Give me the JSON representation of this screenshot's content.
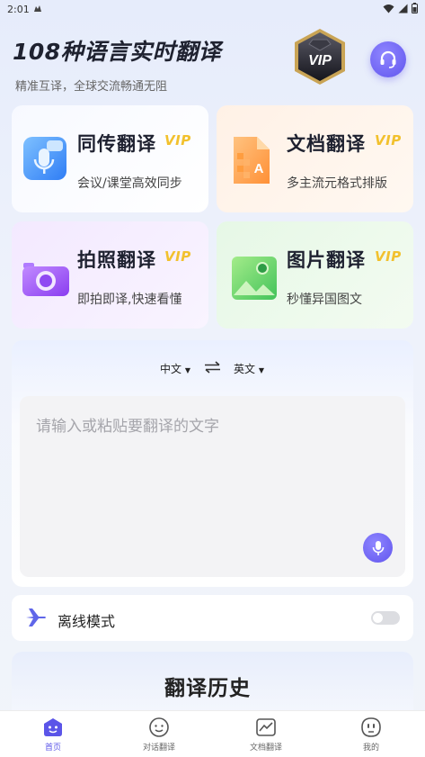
{
  "status_bar": {
    "time": "2:01",
    "app_icon": "notification-icon"
  },
  "header": {
    "title": "108种语言实时翻译",
    "subtitle": "精准互译，全球交流畅通无阻",
    "vip_badge": "VIP"
  },
  "cards": [
    {
      "id": "interp",
      "title": "同传翻译",
      "vip": "VIP",
      "desc": "会议/课堂高效同步",
      "icon": "microphone-icon"
    },
    {
      "id": "doc",
      "title": "文档翻译",
      "vip": "VIP",
      "desc": "多主流元格式排版",
      "icon": "document-icon"
    },
    {
      "id": "photo",
      "title": "拍照翻译",
      "vip": "VIP",
      "desc": "即拍即译,快速看懂",
      "icon": "camera-icon"
    },
    {
      "id": "image",
      "title": "图片翻译",
      "vip": "VIP",
      "desc": "秒懂异国图文",
      "icon": "picture-icon"
    }
  ],
  "translator": {
    "source_lang": "中文",
    "target_lang": "英文",
    "placeholder": "请输入或粘贴要翻译的文字"
  },
  "offline": {
    "label": "离线模式",
    "enabled": false
  },
  "history": {
    "title": "翻译历史"
  },
  "nav": [
    {
      "label": "首页",
      "icon": "home-face-icon",
      "active": true
    },
    {
      "label": "对话翻译",
      "icon": "chat-icon",
      "active": false
    },
    {
      "label": "文档翻译",
      "icon": "chart-doc-icon",
      "active": false
    },
    {
      "label": "我的",
      "icon": "profile-icon",
      "active": false
    }
  ],
  "colors": {
    "accent": "#5b55e8",
    "vip_gold": "#f2c12e"
  }
}
